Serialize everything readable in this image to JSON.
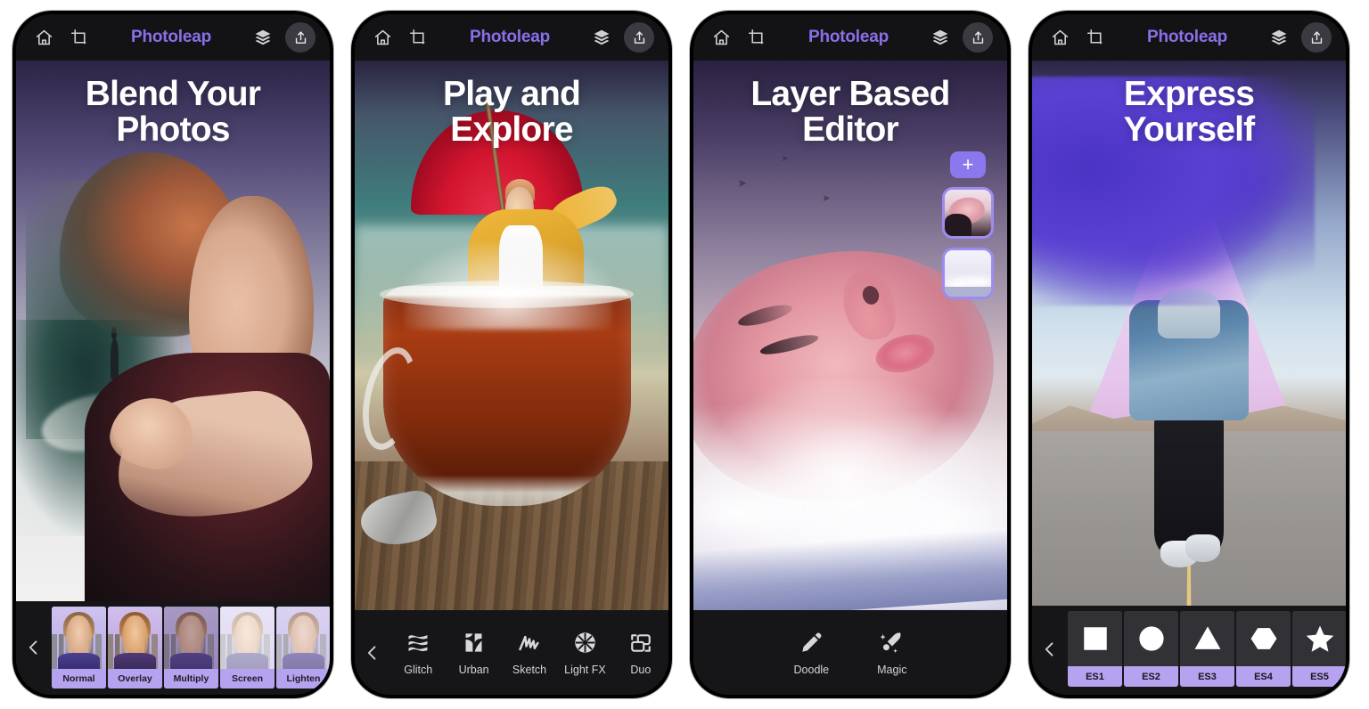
{
  "app": {
    "name": "Photoleap",
    "accent_purple": "#8b6fe8",
    "label_purple": "#b5a3f0",
    "topbar_bg": "#131316",
    "bottombar_bg": "#161618"
  },
  "topbar": {
    "home_icon": "home-icon",
    "crop_icon": "crop-icon",
    "title": "Photoleap",
    "layers_icon": "layers-icon",
    "share_icon": "share-icon"
  },
  "panels": [
    {
      "id": "blend",
      "headline": "Blend Your\nPhotos",
      "back_chevron": "chevron-left-icon",
      "bottom_type": "filters",
      "filters": [
        {
          "label": "Normal",
          "mode": "fm-normal"
        },
        {
          "label": "Overlay",
          "mode": "fm-over"
        },
        {
          "label": "Multiply",
          "mode": "fm-mult"
        },
        {
          "label": "Screen",
          "mode": "fm-screen"
        },
        {
          "label": "Lighten",
          "mode": "fm-light"
        }
      ]
    },
    {
      "id": "play",
      "headline": "Play and\nExplore",
      "back_chevron": "chevron-left-icon",
      "bottom_type": "tools",
      "tools": [
        {
          "label": "Glitch",
          "icon": "glitch-icon"
        },
        {
          "label": "Urban",
          "icon": "urban-icon"
        },
        {
          "label": "Sketch",
          "icon": "sketch-icon"
        },
        {
          "label": "Light FX",
          "icon": "lightfx-icon"
        },
        {
          "label": "Duo",
          "icon": "duo-icon"
        }
      ]
    },
    {
      "id": "layers",
      "headline": "Layer Based\nEditor",
      "bottom_type": "tools-centered",
      "tools": [
        {
          "label": "Doodle",
          "icon": "pencil-icon"
        },
        {
          "label": "Magic",
          "icon": "magic-wand-icon"
        }
      ],
      "layer_panel": {
        "add_label": "+",
        "thumbnails": [
          "layer-thumb-face",
          "layer-thumb-clouds"
        ]
      }
    },
    {
      "id": "express",
      "headline": "Express\nYourself",
      "back_chevron": "chevron-left-icon",
      "bottom_type": "shapes",
      "shapes": [
        {
          "label": "ES1",
          "glyph": "square-shape-icon"
        },
        {
          "label": "ES2",
          "glyph": "circle-shape-icon"
        },
        {
          "label": "ES3",
          "glyph": "triangle-shape-icon"
        },
        {
          "label": "ES4",
          "glyph": "hexagon-shape-icon"
        },
        {
          "label": "ES5",
          "glyph": "star-shape-icon"
        }
      ]
    }
  ]
}
